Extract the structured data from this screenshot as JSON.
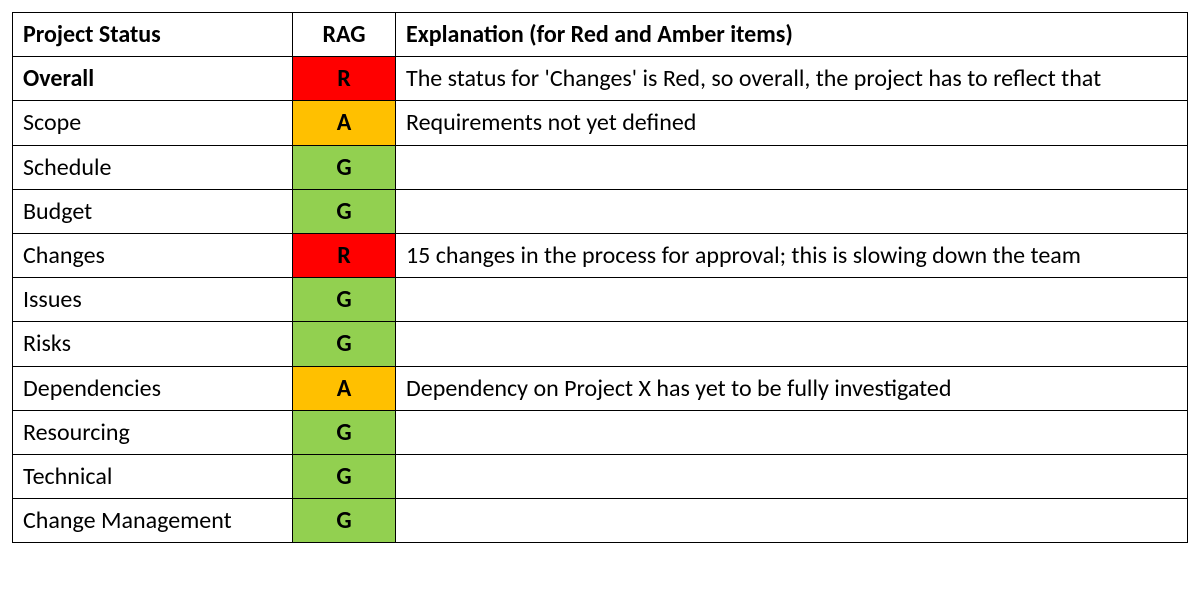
{
  "headers": {
    "status": "Project Status",
    "rag": "RAG",
    "explanation": "Explanation (for Red and Amber items)"
  },
  "rows": [
    {
      "status": "Overall",
      "rag": "R",
      "explanation": "The status for 'Changes' is Red, so overall, the project has to reflect that",
      "bold": true
    },
    {
      "status": "Scope",
      "rag": "A",
      "explanation": "Requirements not yet defined",
      "bold": false
    },
    {
      "status": "Schedule",
      "rag": "G",
      "explanation": "",
      "bold": false
    },
    {
      "status": "Budget",
      "rag": "G",
      "explanation": "",
      "bold": false
    },
    {
      "status": "Changes",
      "rag": "R",
      "explanation": "15 changes in the process for approval; this is slowing down the team",
      "bold": false
    },
    {
      "status": "Issues",
      "rag": "G",
      "explanation": "",
      "bold": false
    },
    {
      "status": "Risks",
      "rag": "G",
      "explanation": "",
      "bold": false
    },
    {
      "status": "Dependencies",
      "rag": "A",
      "explanation": "Dependency on Project X has yet to be fully investigated",
      "bold": false
    },
    {
      "status": "Resourcing",
      "rag": "G",
      "explanation": "",
      "bold": false
    },
    {
      "status": "Technical",
      "rag": "G",
      "explanation": "",
      "bold": false
    },
    {
      "status": "Change Management",
      "rag": "G",
      "explanation": "",
      "bold": false
    }
  ],
  "rag_colors": {
    "R": "#ff0000",
    "A": "#ffc000",
    "G": "#92d050"
  }
}
